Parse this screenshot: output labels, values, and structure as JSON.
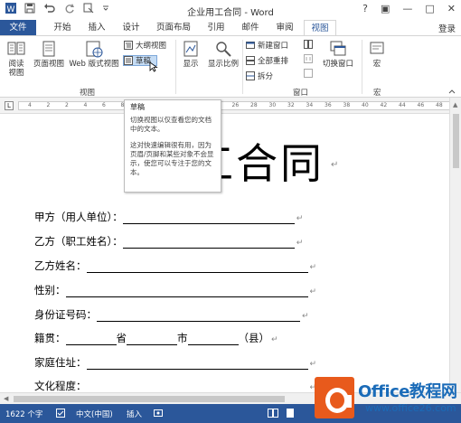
{
  "title": "企业用工合同 - Word",
  "window_controls": {
    "help": "?",
    "restore": "▣",
    "minimize": "—",
    "maximize": "□",
    "close": "✕"
  },
  "tabs": {
    "file": "文件",
    "items": [
      "开始",
      "插入",
      "设计",
      "页面布局",
      "引用",
      "邮件",
      "审阅",
      "视图"
    ],
    "active": "视图",
    "login": "登录"
  },
  "ribbon": {
    "views": {
      "read_mode": "阅读\n视图",
      "print_layout": "页面视图",
      "web_layout": "Web 版式视图",
      "outline": "大纲视图",
      "draft": "草稿",
      "group_label": "视图"
    },
    "show": "显示",
    "zoom": "显示比例",
    "window": {
      "new_window": "新建窗口",
      "arrange_all": "全部重排",
      "split": "拆分",
      "switch_windows": "切换窗口",
      "group_label": "窗口"
    },
    "macros": {
      "label": "宏",
      "group_label": "宏"
    }
  },
  "ruler_labels": [
    "4",
    "2",
    "2",
    "4",
    "6",
    "8",
    "16",
    "18",
    "20",
    "22",
    "24",
    "26",
    "28",
    "30",
    "32",
    "34",
    "36",
    "38",
    "40",
    "42",
    "44",
    "46",
    "48"
  ],
  "tooltip": {
    "title": "草稿",
    "body1": "切换视图以仅查看您的文档中的文本。",
    "body2": "这对快速编辑很有用，因为页眉/页脚和某些对象不会显示，使您可以专注于您的文本。"
  },
  "document": {
    "title": "工合同",
    "fields": [
      {
        "label": "甲方（用人单位）："
      },
      {
        "label": "乙方（职工姓名）："
      },
      {
        "label": "乙方姓名："
      },
      {
        "label": "性别："
      },
      {
        "label": "身份证号码："
      },
      {
        "label": "籍贯：",
        "p1": "省",
        "p2": "市",
        "p3": "（县）"
      },
      {
        "label": "家庭住址："
      },
      {
        "label": "文化程度："
      }
    ]
  },
  "status": {
    "word_count": "1622 个字",
    "language": "中文(中国)",
    "mode": "插入"
  },
  "watermark": {
    "brand": "Office教程网",
    "url": "www.office26.com"
  }
}
